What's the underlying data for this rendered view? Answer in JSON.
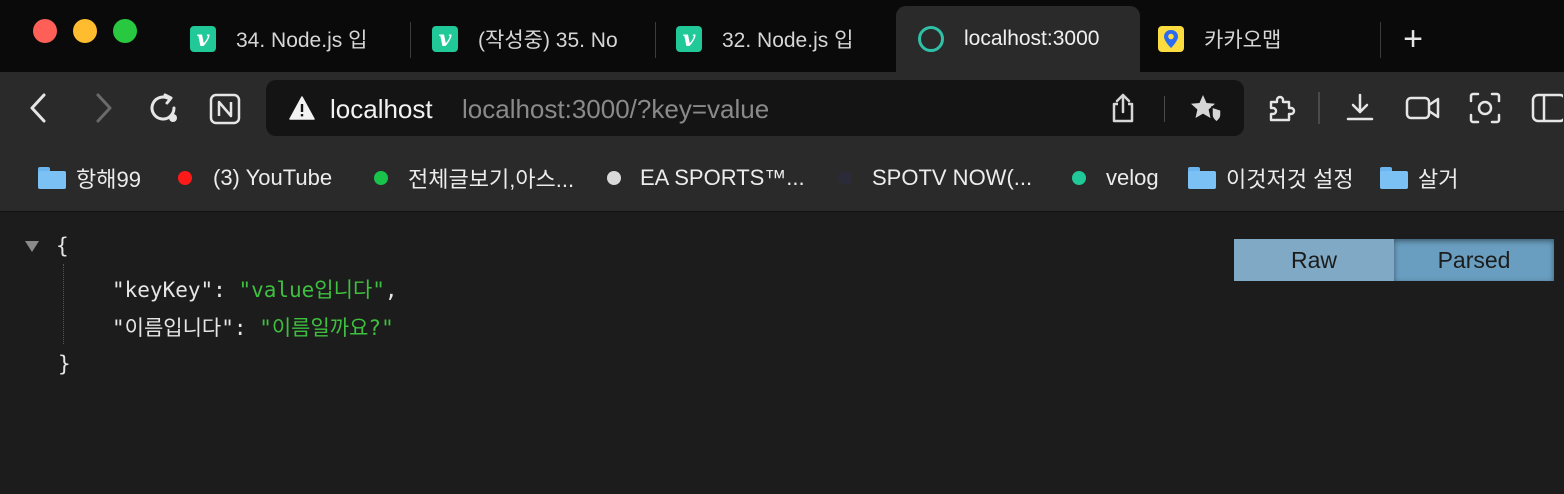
{
  "tabs": [
    {
      "title": "34. Node.js 입",
      "favicon": "velog-v-icon",
      "favicon_glyph": "v",
      "active": false
    },
    {
      "title": "(작성중) 35. No",
      "favicon": "velog-v-icon",
      "favicon_glyph": "v",
      "active": false
    },
    {
      "title": "32. Node.js 입",
      "favicon": "velog-v-icon",
      "favicon_glyph": "v",
      "active": false
    },
    {
      "title": "localhost:3000",
      "favicon": "loading-ring-icon",
      "favicon_glyph": "",
      "active": true
    },
    {
      "title": "카카오맵",
      "favicon": "kakaomap-pin-icon",
      "favicon_glyph": "",
      "active": false
    }
  ],
  "new_tab_glyph": "+",
  "address": {
    "host": "localhost",
    "url": "localhost:3000/?key=value",
    "security": "warning-icon"
  },
  "bookmarks": [
    {
      "label": "항해99",
      "icon": "folder",
      "color": "#7cc1f4"
    },
    {
      "label": "(3) YouTube",
      "icon": "dot",
      "color": "#ff1a1a"
    },
    {
      "label": "전체글보기,아스...",
      "icon": "dot",
      "color": "#19c24a"
    },
    {
      "label": "EA SPORTS™...",
      "icon": "dot",
      "color": "#d9d9d9"
    },
    {
      "label": "SPOTV NOW(...",
      "icon": "dot",
      "color": "#2a2a38"
    },
    {
      "label": "velog",
      "icon": "dot",
      "color": "#20c997"
    },
    {
      "label": "이것저것 설정",
      "icon": "folder",
      "color": "#7cc1f4"
    },
    {
      "label": "살거",
      "icon": "folder",
      "color": "#7cc1f4"
    }
  ],
  "json_viewer": {
    "open_brace": "{",
    "close_brace": "}",
    "entries": [
      {
        "key": "\"keyKey\"",
        "value": "\"value입니다\"",
        "comma": ","
      },
      {
        "key": "\"이름입니다\"",
        "value": "\"이름일까요?\"",
        "comma": ""
      }
    ],
    "raw_label": "Raw",
    "parsed_label": "Parsed",
    "selected_view": "Parsed"
  },
  "colors": {
    "tab_active_bg": "#2a2a2a",
    "json_string": "#3fbf3f",
    "velog_green": "#20c997"
  }
}
